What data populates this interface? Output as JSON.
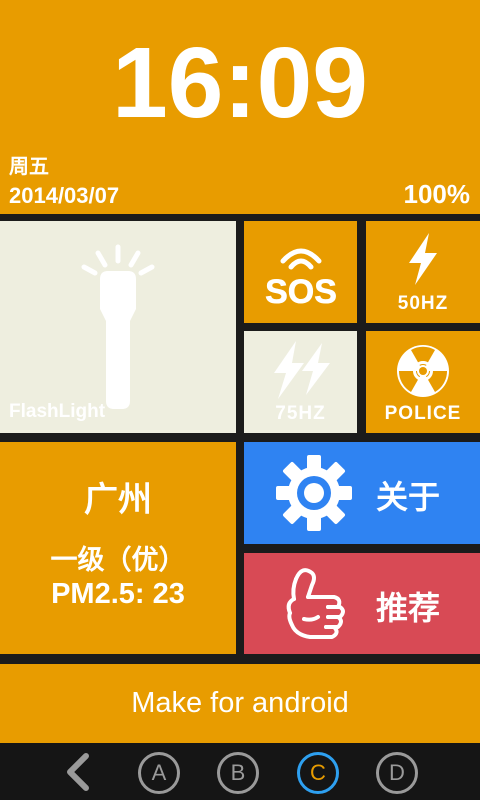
{
  "header": {
    "time": "16:09",
    "weekday": "周五",
    "date": "2014/03/07",
    "battery": "100%"
  },
  "tiles": {
    "flashlight": {
      "label": "FlashLight",
      "icon": "flashlight-icon"
    },
    "sos": {
      "icon": "sos-icon"
    },
    "hz50": {
      "label": "50HZ",
      "icon": "lightning-icon"
    },
    "hz75": {
      "label": "75HZ",
      "icon": "double-lightning-icon"
    },
    "police": {
      "label": "POLICE",
      "icon": "radiation-icon"
    },
    "air_quality": {
      "city": "广州",
      "level": "一级（优）",
      "pm25": "PM2.5: 23"
    },
    "about": {
      "label": "关于",
      "icon": "gear-icon"
    },
    "recommend": {
      "label": "推荐",
      "icon": "thumbs-up-icon"
    }
  },
  "footer": {
    "text": "Make for android"
  },
  "navbar": {
    "back_icon": "back-arrow-icon",
    "buttons": [
      "A",
      "B",
      "C",
      "D"
    ],
    "active": "C"
  },
  "colors": {
    "orange": "#e89c00",
    "cream": "#eeeedf",
    "blue": "#2f83f2",
    "red": "#d84a55",
    "nav_active_ring": "#2ea0f0"
  }
}
